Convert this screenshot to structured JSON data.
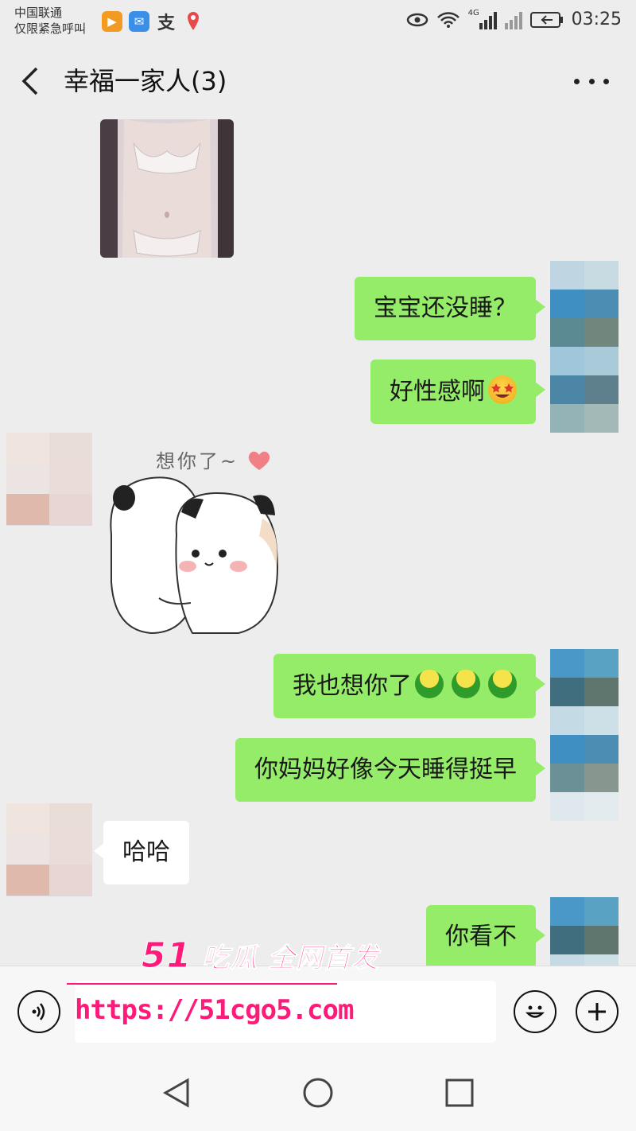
{
  "status_bar": {
    "carrier_line1": "中国联通",
    "carrier_line2": "仅限紧急呼叫",
    "notif_alipay": "支",
    "network_label": "4G",
    "time": "03:25"
  },
  "header": {
    "title": "幸福一家人(3)"
  },
  "messages": [
    {
      "type": "image",
      "direction": "in"
    },
    {
      "type": "text",
      "direction": "out",
      "text": "宝宝还没睡？"
    },
    {
      "type": "text",
      "direction": "out",
      "text": "好性感啊",
      "emoji": "star-struck"
    },
    {
      "type": "sticker",
      "direction": "in",
      "caption": "想你了~"
    },
    {
      "type": "text",
      "direction": "out",
      "text": "我也想你了",
      "emoji": "green-figure x3"
    },
    {
      "type": "text",
      "direction": "out",
      "text": "你妈妈好像今天睡得挺早"
    },
    {
      "type": "text",
      "direction": "in",
      "text": "哈哈"
    },
    {
      "type": "text",
      "direction": "out",
      "text": "你看不"
    }
  ],
  "watermark": {
    "brand_num": "51",
    "brand_text": "吃瓜 全网首发",
    "url": "https://51cgo5.com"
  },
  "colors": {
    "background": "#ededed",
    "bubble_out": "#95ec69",
    "bubble_in": "#ffffff",
    "watermark": "#ff1a7a"
  }
}
